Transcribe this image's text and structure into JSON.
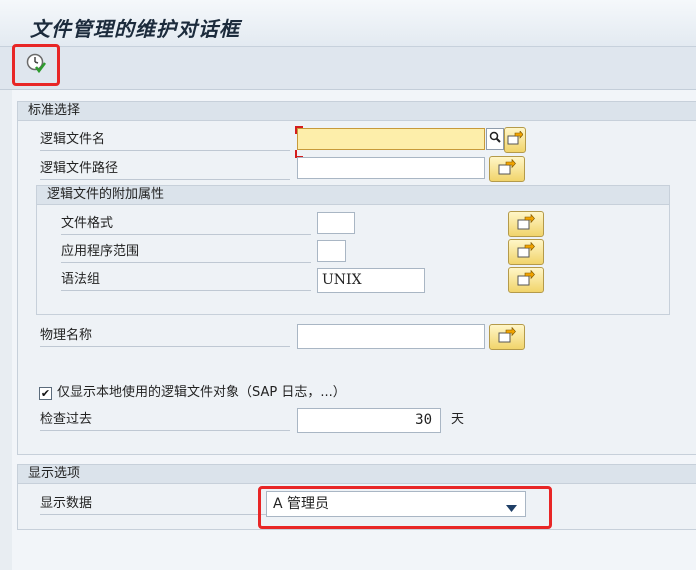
{
  "window": {
    "title": "文件管理的维护对话框"
  },
  "toolbar": {
    "execute_icon": "clock-check-icon"
  },
  "standard_selection": {
    "header": "标准选择",
    "logical_file_name": {
      "label": "逻辑文件名",
      "value": ""
    },
    "logical_file_path": {
      "label": "逻辑文件路径",
      "value": ""
    },
    "additional_attributes": {
      "header": "逻辑文件的附加属性",
      "file_format": {
        "label": "文件格式",
        "value": ""
      },
      "application_area": {
        "label": "应用程序范围",
        "value": ""
      },
      "syntax_group": {
        "label": "语法组",
        "value": "UNIX"
      }
    },
    "physical_name": {
      "label": "物理名称",
      "value": ""
    },
    "local_only": {
      "label": "仅显示本地使用的逻辑文件对象（SAP 日志，...）",
      "checked": true,
      "check_glyph": "✔"
    },
    "check_past": {
      "label": "检查过去",
      "value": "30",
      "unit": "天"
    }
  },
  "display_options": {
    "header": "显示选项",
    "display_data": {
      "label": "显示数据",
      "selected": "A 管理员"
    }
  },
  "colors": {
    "highlight": "#e82626",
    "required_field": "#fdeeaa"
  }
}
